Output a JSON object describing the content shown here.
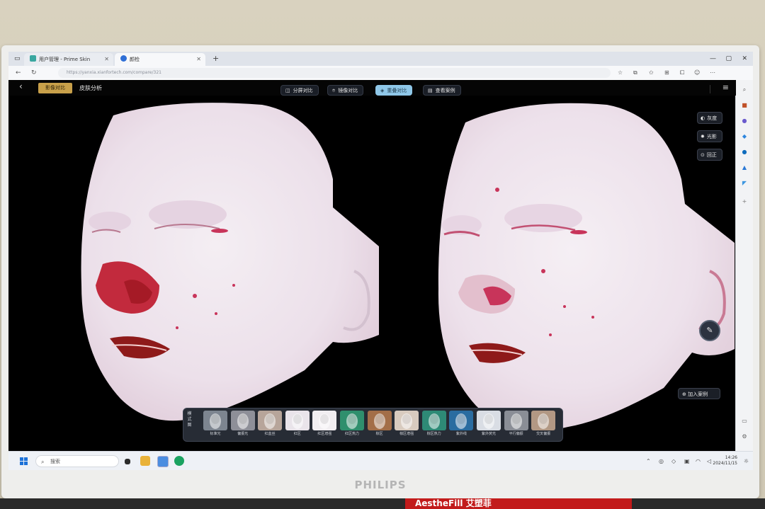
{
  "browser": {
    "tabs": [
      {
        "label": "用户管理 - Prime Skin",
        "color": "#3aa7a0"
      },
      {
        "label": "颜检",
        "color": "#2f6fd6"
      }
    ],
    "new_tab": "+",
    "url": "https://yanxia.xianfortech.com/compare/321"
  },
  "app": {
    "back_icon": "chevron-left",
    "header_primary_label": "影像对比",
    "header_link_label": "皮肤分析",
    "toolbar": [
      {
        "label": "分屏对比",
        "icon": "split-icon",
        "active": false
      },
      {
        "label": "镜像对比",
        "icon": "pin-icon",
        "active": false
      },
      {
        "label": "重叠对比",
        "icon": "overlay-icon",
        "active": true
      },
      {
        "label": "查看案例",
        "icon": "case-icon",
        "active": false
      }
    ],
    "side_controls": [
      {
        "label": "灰度",
        "icon": "contrast-icon"
      },
      {
        "label": "光影",
        "icon": "sun-icon"
      },
      {
        "label": "回正",
        "icon": "reset-icon"
      }
    ],
    "fab_icon": "note-icon",
    "add_case_label": "加入案例"
  },
  "thumbnails": {
    "header": "模式图",
    "items": [
      {
        "label": "标准光",
        "tone": "#7d8590"
      },
      {
        "label": "偏振光",
        "tone": "#8e8f98"
      },
      {
        "label": "红血丝",
        "tone": "#b7a59a"
      },
      {
        "label": "红区",
        "tone": "#e9e4ea"
      },
      {
        "label": "红区增强",
        "tone": "#f1eef1"
      },
      {
        "label": "红区热力",
        "tone": "#2f8f6d"
      },
      {
        "label": "棕区",
        "tone": "#a36e48"
      },
      {
        "label": "棕区增强",
        "tone": "#d8cbbf"
      },
      {
        "label": "棕区热力",
        "tone": "#2e8a76"
      },
      {
        "label": "紫外线",
        "tone": "#2a6ca0"
      },
      {
        "label": "紫外荧光",
        "tone": "#d9dde4"
      },
      {
        "label": "平行偏振",
        "tone": "#8a8e96"
      },
      {
        "label": "交叉偏振",
        "tone": "#b29884"
      }
    ]
  },
  "taskbar": {
    "search_placeholder": "搜索",
    "time": "14:26",
    "date": "2024/11/15"
  },
  "monitor_brand": "PHILIPS",
  "desk_label": "AestheFill 艾塑菲"
}
